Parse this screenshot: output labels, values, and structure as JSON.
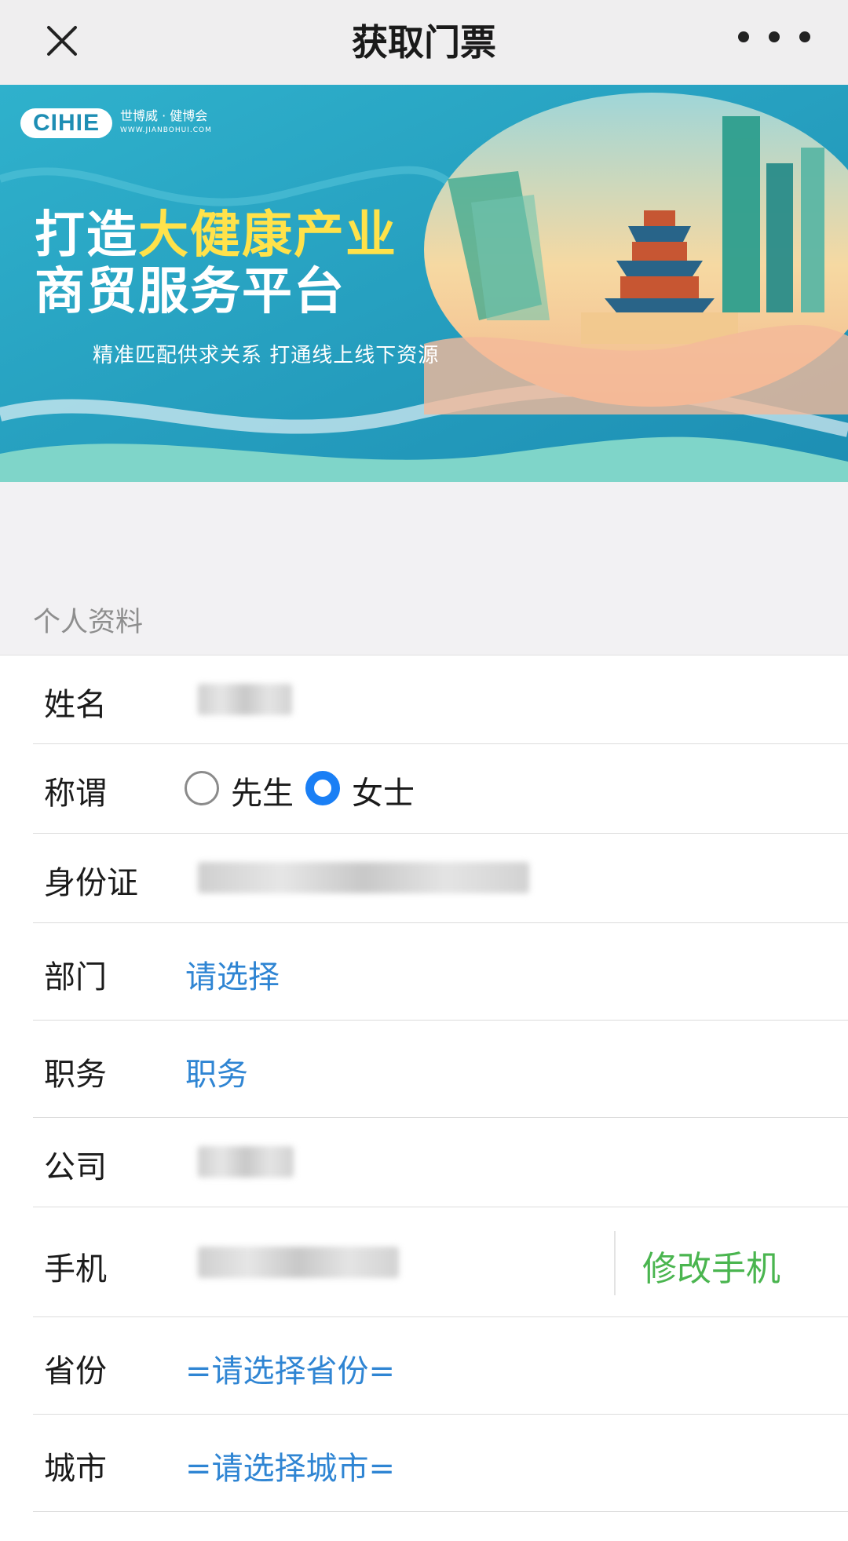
{
  "header": {
    "title": "获取门票"
  },
  "banner": {
    "logo": "CIHIE",
    "logo_cn": "世博威 · 健博会",
    "logo_url": "WWW.JIANBOHUI.COM",
    "line1_prefix": "打造",
    "line1_highlight": "大健康产业",
    "line2": "商贸服务平台",
    "subtitle": "精准匹配供求关系 打通线上线下资源"
  },
  "section": {
    "title": "个人资料"
  },
  "form": {
    "name_label": "姓名",
    "salutation_label": "称谓",
    "salutation_options": [
      "先生",
      "女士"
    ],
    "salutation_selected": "女士",
    "id_label": "身份证",
    "department_label": "部门",
    "department_value": "请选择",
    "position_label": "职务",
    "position_value": "职务",
    "company_label": "公司",
    "phone_label": "手机",
    "change_phone_label": "修改手机",
    "province_label": "省份",
    "province_value": "=请选择省份=",
    "city_label": "城市",
    "city_value": "=请选择城市="
  },
  "colors": {
    "link_blue": "#2f85d3",
    "radio_blue": "#1a7ff5",
    "action_green": "#4ab54f",
    "banner_teal": "#22a3c4",
    "highlight_yellow": "#ffe24a"
  }
}
